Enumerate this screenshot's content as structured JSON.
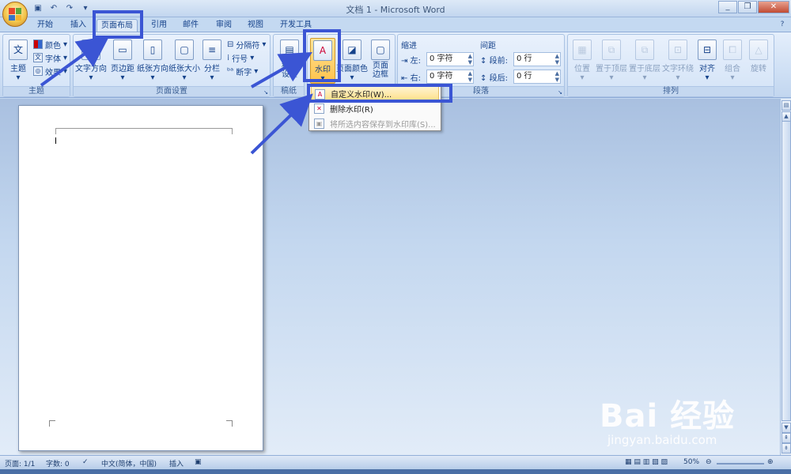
{
  "app": {
    "title": "文档 1 - Microsoft Word",
    "window_controls": {
      "minimize": "_",
      "restore": "❐",
      "close": "✕"
    }
  },
  "tabs": [
    "开始",
    "插入",
    "页面布局",
    "引用",
    "邮件",
    "审阅",
    "视图",
    "开发工具"
  ],
  "ribbon": {
    "theme_group": {
      "label": "主题",
      "themes": "主题",
      "colors": "颜色",
      "fonts": "字体",
      "effects": "效果"
    },
    "page_setup_group": {
      "label": "页面设置",
      "text_direction": "文字方向",
      "margins": "页边距",
      "orientation": "纸张方向",
      "size": "纸张大小",
      "columns": "分栏",
      "breaks": "分隔符",
      "line_numbers": "行号",
      "hyphenation": "断字"
    },
    "manuscript_group": {
      "label": "稿纸",
      "setup": "稿纸\n设置"
    },
    "page_background_group": {
      "watermark": "水印",
      "page_color": "页面颜色",
      "page_borders": "页面\n边框"
    },
    "paragraph_group": {
      "label": "段落",
      "indent_title": "缩进",
      "spacing_title": "间距",
      "indent_left_label": "左:",
      "indent_left_value": "0 字符",
      "indent_right_label": "右:",
      "indent_right_value": "0 字符",
      "spacing_before_label": "段前:",
      "spacing_before_value": "0 行",
      "spacing_after_label": "段后:",
      "spacing_after_value": "0 行"
    },
    "arrange_group": {
      "label": "排列",
      "position": "位置",
      "bring_front": "置于顶层",
      "send_back": "置于底层",
      "text_wrap": "文字环绕",
      "align": "对齐",
      "group": "组合",
      "rotate": "旋转"
    }
  },
  "watermark_menu": {
    "custom": "自定义水印(W)...",
    "remove": "删除水印(R)",
    "save_selection": "将所选内容保存到水印库(S)..."
  },
  "status_bar": {
    "page": "页面: 1/1",
    "words": "字数: 0",
    "language": "中文(简体，中国)",
    "insert_mode": "插入",
    "zoom": "50%"
  },
  "watermark_text": {
    "logo": "Bai 经验",
    "url": "jingyan.baidu.com"
  },
  "colors": {
    "highlight": "#3b55d4",
    "ribbon_bg": "#dde9f7",
    "doc_bg": "#c3d7ef"
  }
}
